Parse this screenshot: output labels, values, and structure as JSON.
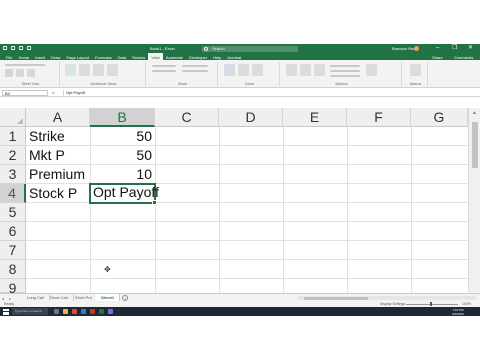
{
  "window": {
    "title": "Book1 - Excel",
    "search_placeholder": "Search",
    "user_name": "Brandon Reed",
    "minimize": "–",
    "restore": "❐",
    "close": "✕"
  },
  "ribbon": {
    "tabs": [
      "File",
      "Home",
      "Insert",
      "Draw",
      "Page Layout",
      "Formulas",
      "Data",
      "Review",
      "View",
      "Automate",
      "Developer",
      "Help",
      "Acrobat"
    ],
    "active_tab": "View",
    "share_label": "Share",
    "comments_label": "Comments",
    "groups": [
      "Sheet View",
      "Workbook Views",
      "Show",
      "Zoom",
      "Window",
      "Macros"
    ]
  },
  "formula_bar": {
    "name_box": "B4",
    "fx_label": "fx",
    "value": "Opt Payoff"
  },
  "grid": {
    "columns": [
      "A",
      "B",
      "C",
      "D",
      "E",
      "F",
      "G"
    ],
    "selected_column": "B",
    "rows": [
      "1",
      "2",
      "3",
      "4",
      "5",
      "6",
      "7",
      "8",
      "9"
    ],
    "selected_row": "4",
    "cells": {
      "A1": "Strike",
      "B1": "50",
      "A2": "Mkt P",
      "B2": "50",
      "A3": "Premium",
      "B3": "10",
      "A4": "Stock P",
      "B4": "Opt Payoff"
    },
    "active_cell": "B4"
  },
  "sheets": {
    "tabs": [
      "Long Call",
      "Short Call",
      "Short Put",
      "Sheet1"
    ],
    "active": "Sheet1",
    "add_label": "+",
    "nav_label": "◂ ▸"
  },
  "status": {
    "ready": "Ready",
    "zoom_label": "Display Settings",
    "zoom_pct": "100%"
  },
  "taskbar": {
    "search_placeholder": "Type here to search",
    "time": "7:16 PM",
    "date": "4/1/2023"
  },
  "colors": {
    "excel_green": "#217346",
    "ribbon_bg": "#f3f3f3",
    "taskbar_bg": "#1d2a36"
  }
}
